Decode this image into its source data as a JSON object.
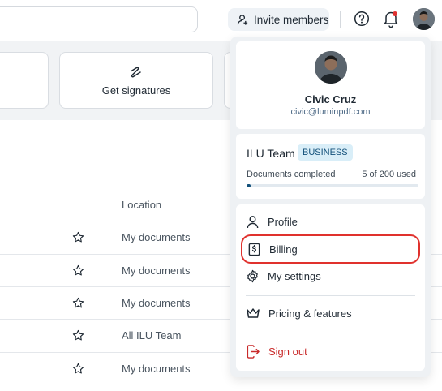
{
  "header": {
    "invite_label": "Invite members"
  },
  "cards": {
    "signatures_label": "Get signatures"
  },
  "table": {
    "location_header": "Location",
    "rows": [
      {
        "location": "My documents"
      },
      {
        "location": "My documents"
      },
      {
        "location": "My documents"
      },
      {
        "location": "All ILU Team"
      },
      {
        "location": "My documents"
      }
    ]
  },
  "account_menu": {
    "profile": {
      "name": "Civic Cruz",
      "email": "civic@luminpdf.com"
    },
    "team": {
      "name": "ILU Team",
      "plan_badge": "BUSINESS",
      "docs_label": "Documents completed",
      "docs_count": "5 of 200 used",
      "docs_progress": 0.025
    },
    "items": {
      "profile": "Profile",
      "billing": "Billing",
      "settings": "My settings",
      "pricing": "Pricing & features",
      "signout": "Sign out"
    }
  },
  "colors": {
    "accent": "#12507a",
    "danger": "#c92a2a",
    "highlight_ring": "#e0312d",
    "notification_dot": "#e03131"
  }
}
